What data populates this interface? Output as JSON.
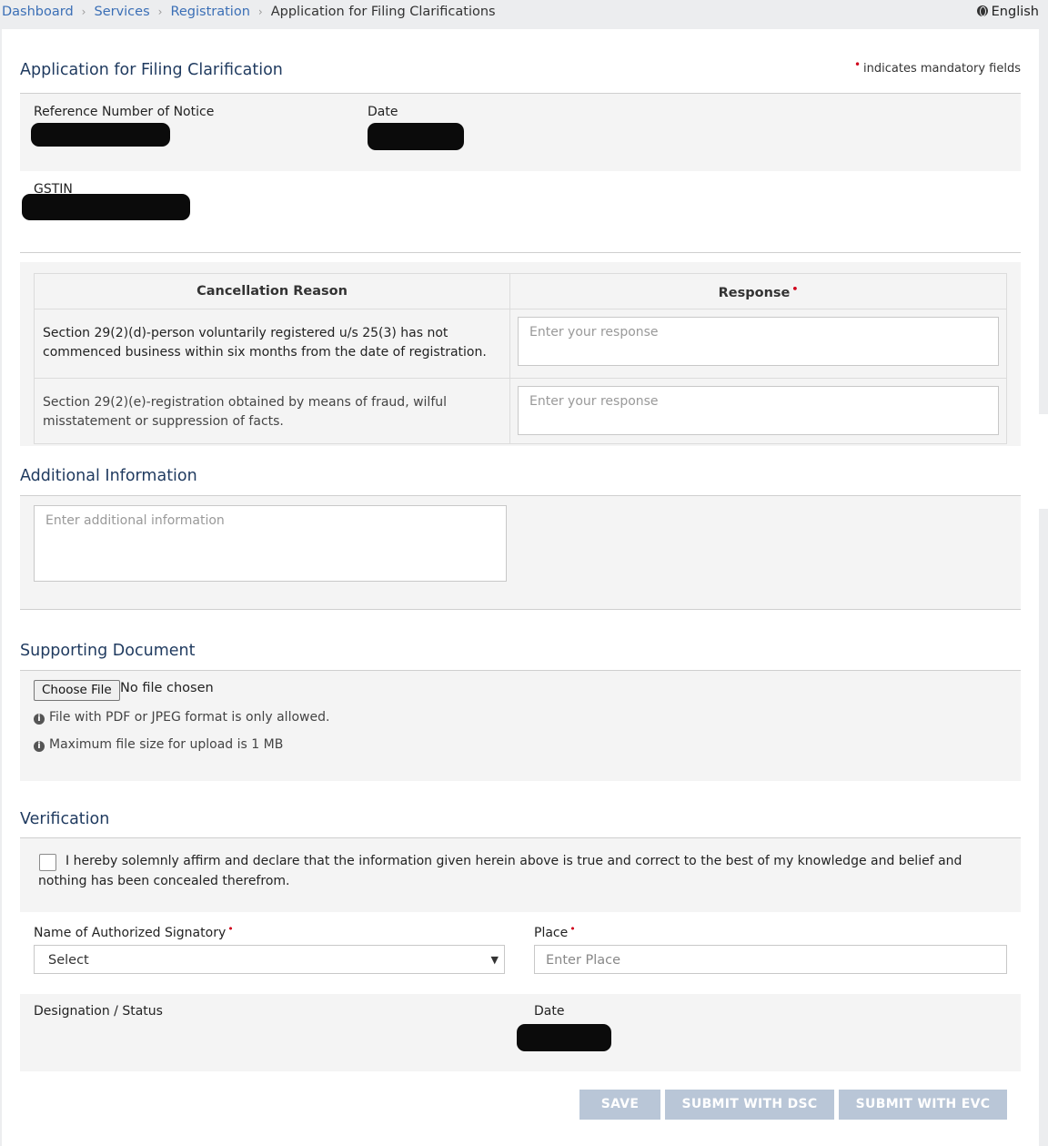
{
  "breadcrumb": {
    "items": [
      "Dashboard",
      "Services",
      "Registration"
    ],
    "current": "Application for Filing Clarifications",
    "separator": "›"
  },
  "language": "English",
  "page": {
    "title": "Application for Filing Clarification",
    "mandatory_note": "indicates mandatory fields",
    "mandatory_marker": "•"
  },
  "notice": {
    "ref_label": "Reference Number of Notice",
    "date_label": "Date",
    "gstin_label": "GSTIN"
  },
  "reasons_table": {
    "col_reason": "Cancellation Reason",
    "col_response": "Response",
    "rows": [
      {
        "reason": "Section 29(2)(d)-person voluntarily registered u/s 25(3) has not commenced business within six months from the date of registration.",
        "response_placeholder": "Enter your response"
      },
      {
        "reason": "Section 29(2)(e)-registration obtained by means of fraud, wilful misstatement or suppression of facts.",
        "response_placeholder": "Enter your response"
      }
    ]
  },
  "additional": {
    "title": "Additional Information",
    "placeholder": "Enter additional information"
  },
  "supporting": {
    "title": "Supporting Document",
    "choose_file": "Choose File",
    "no_file": "No file chosen",
    "note_format": "File with PDF or JPEG format is only allowed.",
    "note_size": "Maximum file size for upload is 1 MB",
    "info_icon": "info-circle-icon"
  },
  "verification": {
    "title": "Verification",
    "declaration": "I hereby solemnly affirm and declare that the information given herein above is true and correct to the best of my knowledge and belief and nothing has been concealed therefrom.",
    "signatory_label": "Name of Authorized Signatory",
    "signatory_value": "Select",
    "place_label": "Place",
    "place_placeholder": "Enter Place",
    "designation_label": "Designation / Status",
    "date_label": "Date"
  },
  "actions": {
    "save": "SAVE",
    "submit_dsc": "SUBMIT WITH DSC",
    "submit_evc": "SUBMIT WITH EVC"
  },
  "colors": {
    "link": "#3b6fb6",
    "heading": "#1f3a5f",
    "required": "#d0021b",
    "button_disabled": "#b9c6d7"
  }
}
